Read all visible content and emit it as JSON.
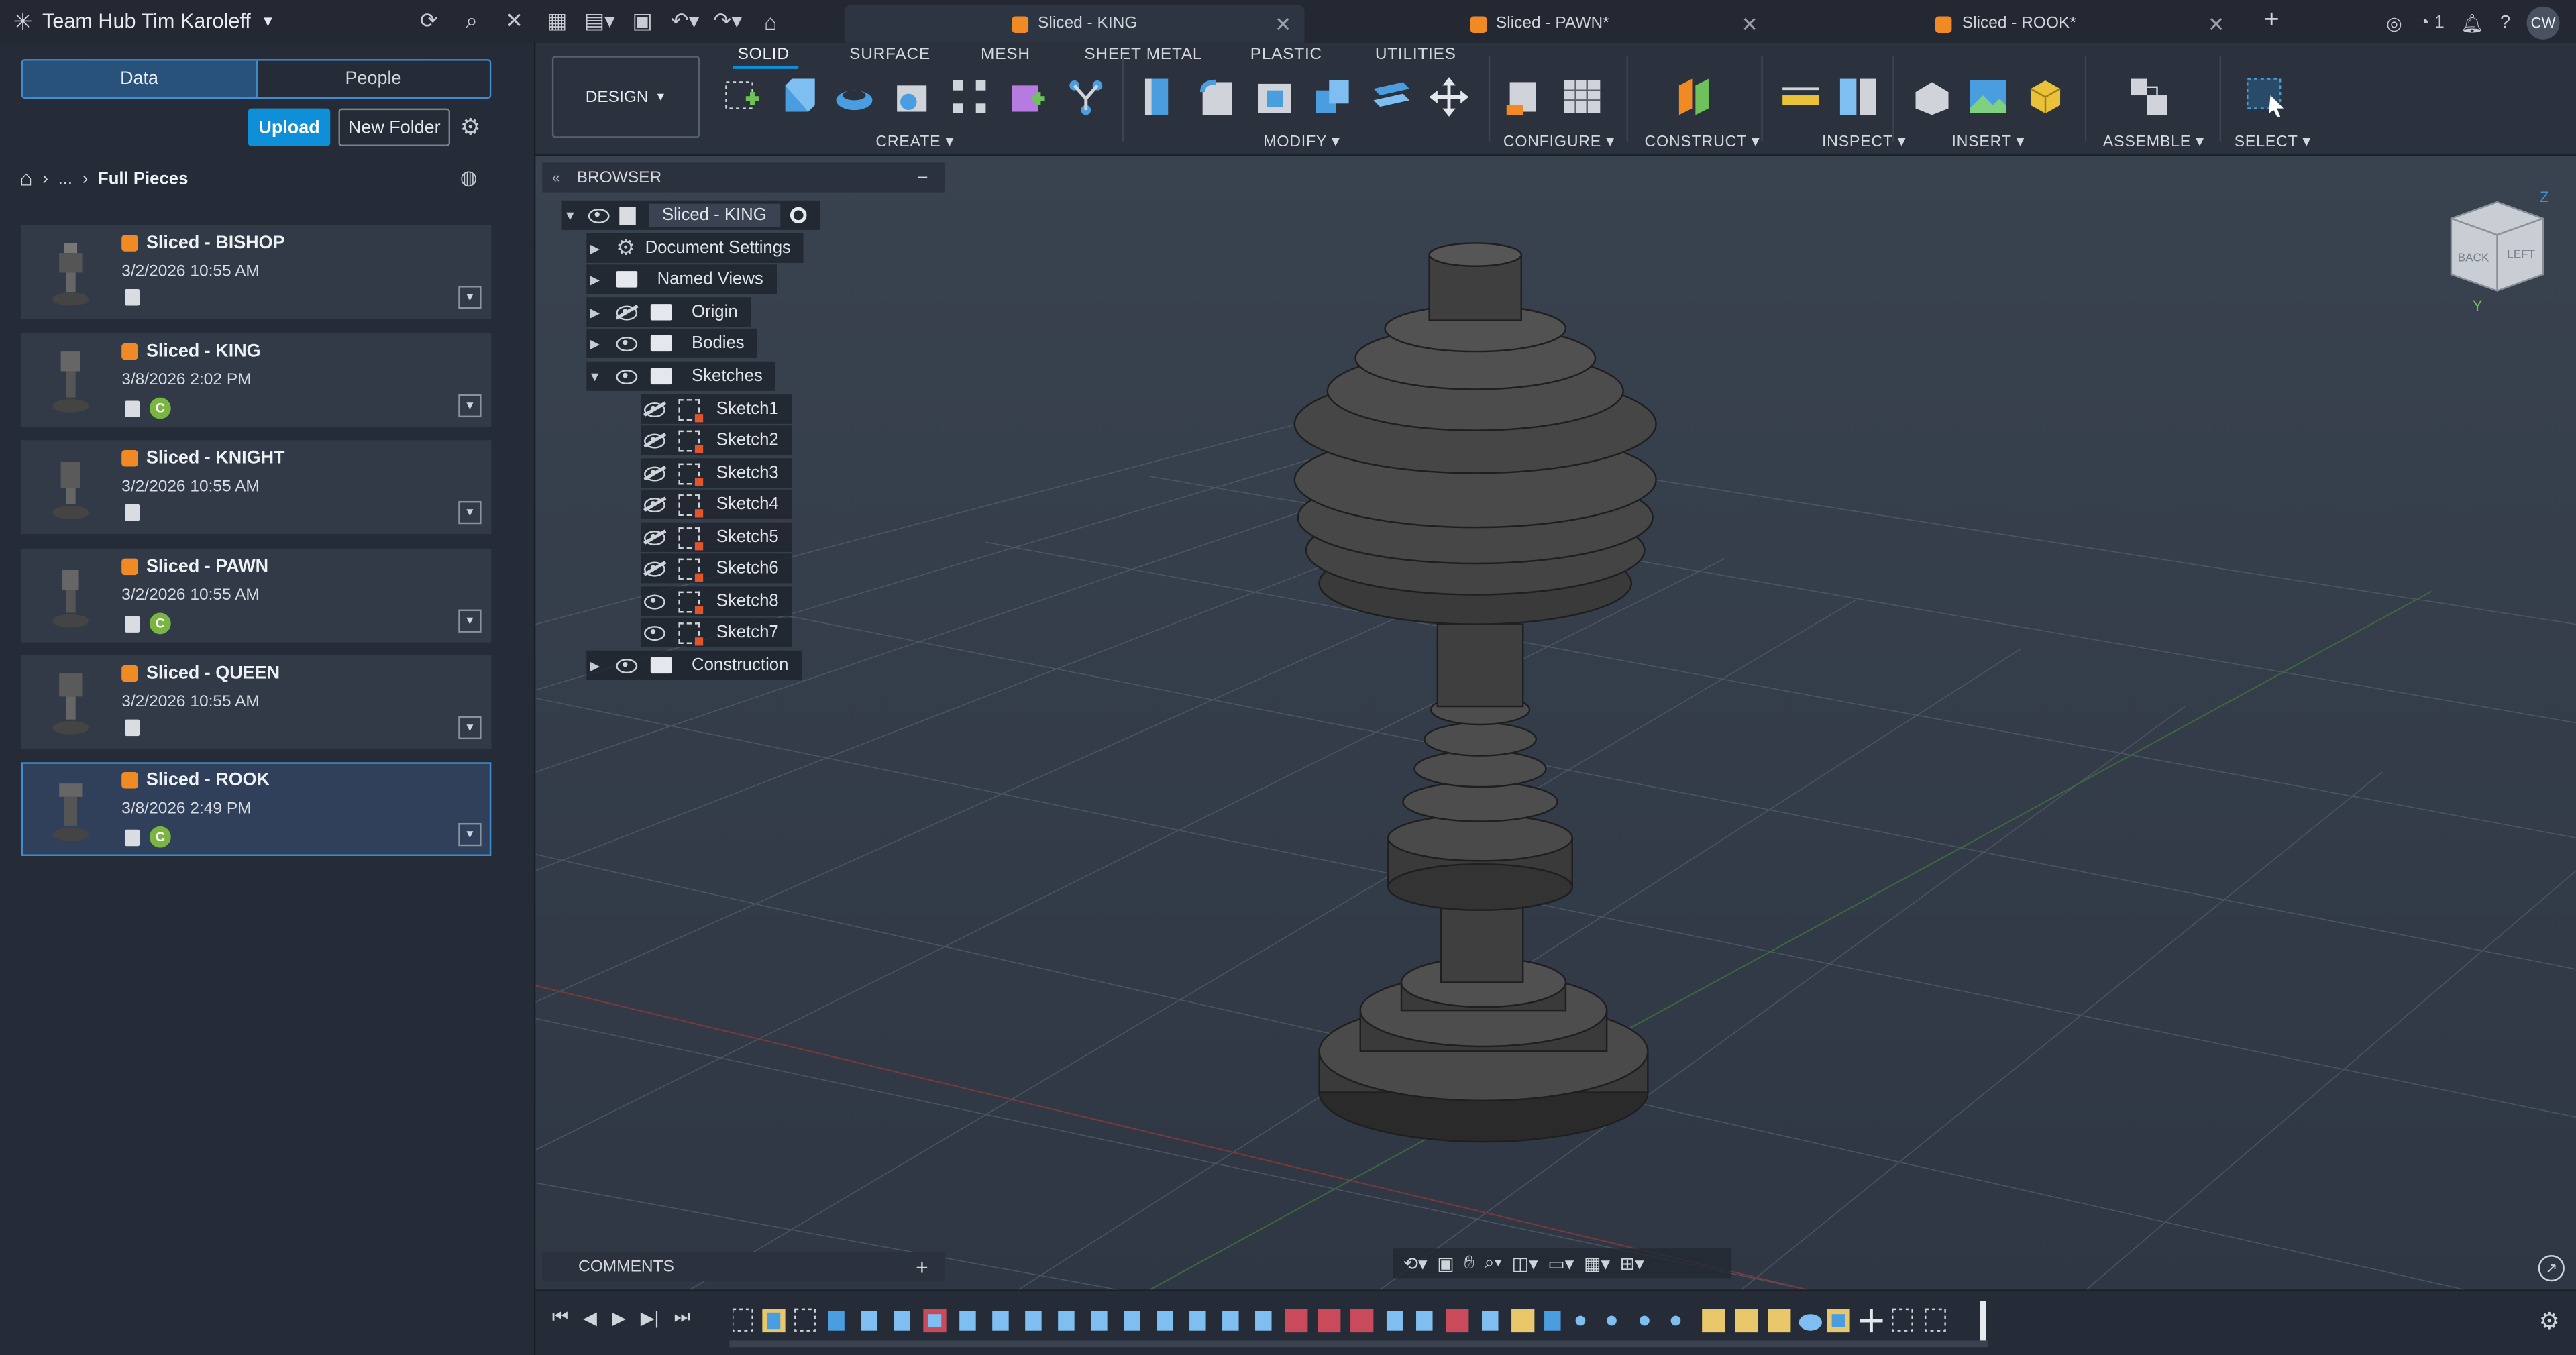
{
  "app": {
    "hub_name": "Team Hub Tim Karoleff"
  },
  "doc_tabs": [
    {
      "label": "Sliced - KING",
      "active": true
    },
    {
      "label": "Sliced - PAWN*",
      "active": false
    },
    {
      "label": "Sliced - ROOK*",
      "active": false
    }
  ],
  "top_right": {
    "notif_count": "1",
    "avatar": "CW"
  },
  "data_panel": {
    "tab_data": "Data",
    "tab_people": "People",
    "upload": "Upload",
    "new_folder": "New Folder",
    "breadcrumb_ellipsis": "...",
    "breadcrumb_folder": "Full Pieces",
    "files": [
      {
        "name": "Sliced - BISHOP",
        "date": "3/2/2026 10:55 AM",
        "badge": false,
        "selected": false
      },
      {
        "name": "Sliced - KING",
        "date": "3/8/2026 2:02 PM",
        "badge": true,
        "selected": false
      },
      {
        "name": "Sliced - KNIGHT",
        "date": "3/2/2026 10:55 AM",
        "badge": false,
        "selected": false
      },
      {
        "name": "Sliced - PAWN",
        "date": "3/2/2026 10:55 AM",
        "badge": true,
        "selected": false
      },
      {
        "name": "Sliced - QUEEN",
        "date": "3/2/2026 10:55 AM",
        "badge": false,
        "selected": false
      },
      {
        "name": "Sliced - ROOK",
        "date": "3/8/2026 2:49 PM",
        "badge": true,
        "selected": true
      }
    ],
    "badge_letter": "C"
  },
  "toolbar": {
    "workspace": "DESIGN",
    "tabs": [
      "SOLID",
      "SURFACE",
      "MESH",
      "SHEET METAL",
      "PLASTIC",
      "UTILITIES"
    ],
    "groups": [
      "CREATE",
      "MODIFY",
      "CONFIGURE",
      "CONSTRUCT",
      "INSPECT",
      "INSERT",
      "ASSEMBLE",
      "SELECT"
    ]
  },
  "browser": {
    "title": "BROWSER",
    "root": "Sliced - KING",
    "items": [
      {
        "label": "Document Settings"
      },
      {
        "label": "Named Views"
      },
      {
        "label": "Origin"
      },
      {
        "label": "Bodies"
      },
      {
        "label": "Sketches"
      }
    ],
    "sketches": [
      "Sketch1",
      "Sketch2",
      "Sketch3",
      "Sketch4",
      "Sketch5",
      "Sketch6",
      "Sketch8",
      "Sketch7"
    ],
    "construction": "Construction"
  },
  "comments": {
    "title": "COMMENTS",
    "add": "+"
  },
  "viewcube": {
    "back": "BACK",
    "left": "LEFT",
    "axis_z": "Z",
    "axis_y": "Y"
  },
  "colors": {
    "accent": "#0f8fd8",
    "brand_orange": "#f08a24",
    "badge_green": "#7bb541",
    "selection_blue": "#3e8ed1"
  }
}
